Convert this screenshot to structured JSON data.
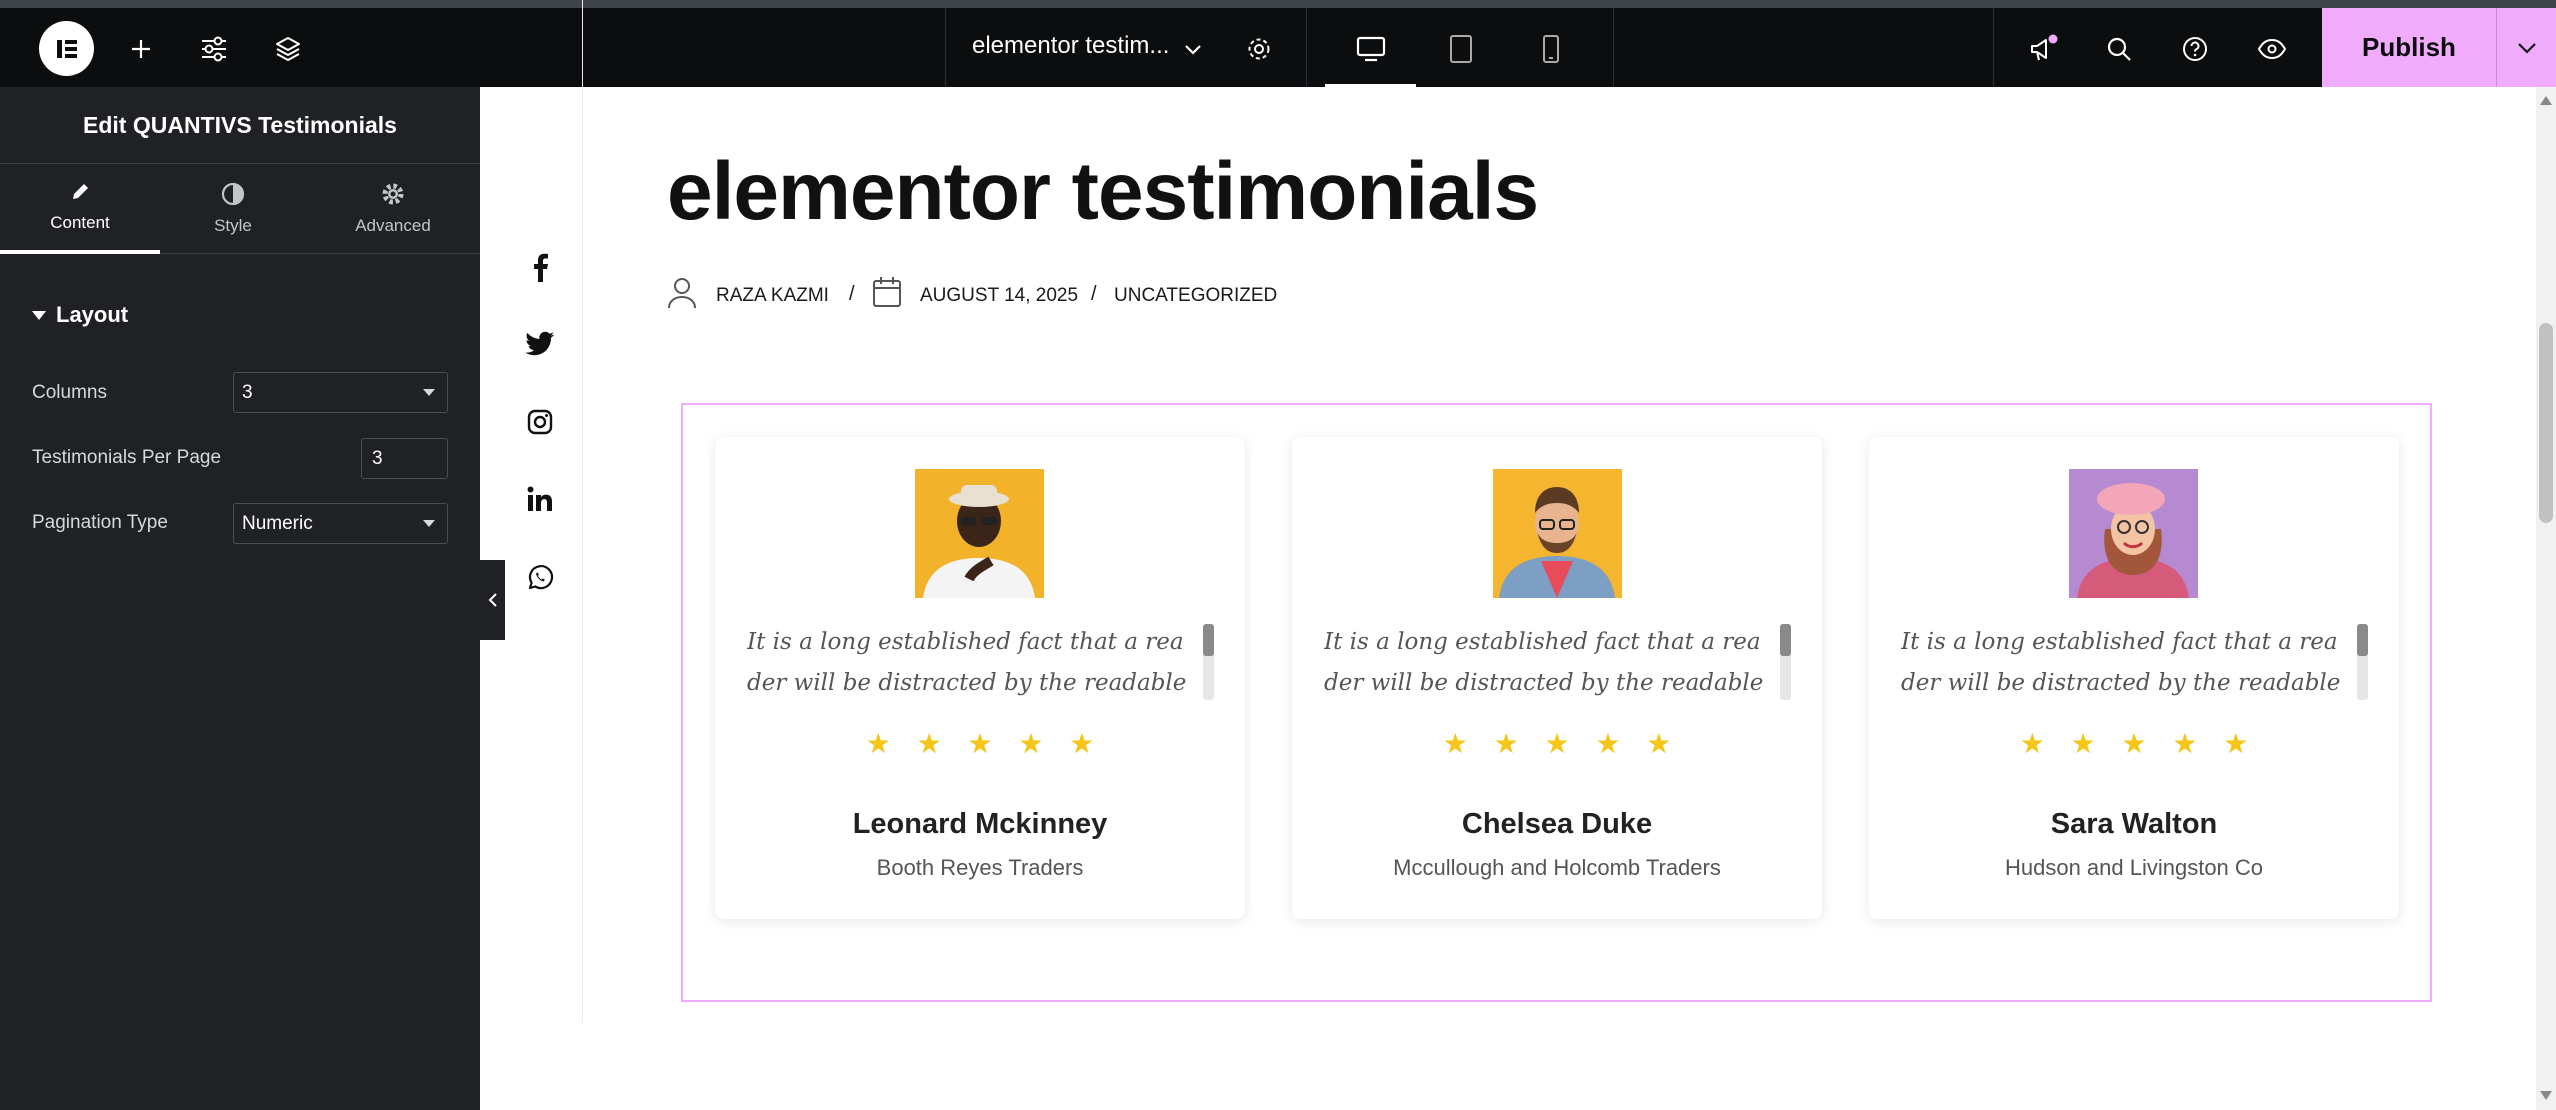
{
  "topbar": {
    "document_title": "elementor testim...",
    "publish_label": "Publish",
    "accent_color": "#f0abfc"
  },
  "panel": {
    "title": "Edit QUANTIVS Testimonials",
    "tabs": [
      {
        "label": "Content",
        "icon": "pencil-icon",
        "active": true
      },
      {
        "label": "Style",
        "icon": "half-circle-icon",
        "active": false
      },
      {
        "label": "Advanced",
        "icon": "gear-icon",
        "active": false
      }
    ],
    "section": "Layout",
    "controls": {
      "columns": {
        "label": "Columns",
        "value": "3"
      },
      "per_page": {
        "label": "Testimonials Per Page",
        "value": "3"
      },
      "pagination": {
        "label": "Pagination Type",
        "value": "Numeric"
      }
    }
  },
  "page": {
    "title": "elementor testimonials",
    "meta": {
      "author": "RAZA KAZMI",
      "date": "AUGUST 14, 2025",
      "category": "UNCATEGORIZED",
      "separator": "/"
    },
    "social_icons": [
      "facebook-icon",
      "twitter-icon",
      "instagram-icon",
      "linkedin-icon",
      "whatsapp-icon"
    ]
  },
  "testimonials": [
    {
      "quote": "It is a long established fact that a reader will be distracted by the readable content of",
      "rating": "★ ★ ★ ★ ★",
      "name": "Leonard Mckinney",
      "company": "Booth Reyes Traders"
    },
    {
      "quote": "It is a long established fact that a reader will be distracted by the readable content of",
      "rating": "★ ★ ★ ★ ★",
      "name": "Chelsea Duke",
      "company": "Mccullough and Holcomb Traders"
    },
    {
      "quote": "It is a long established fact that a reader will be distracted by the readable content of",
      "rating": "★ ★ ★ ★ ★",
      "name": "Sara Walton",
      "company": "Hudson and Livingston Co"
    }
  ]
}
